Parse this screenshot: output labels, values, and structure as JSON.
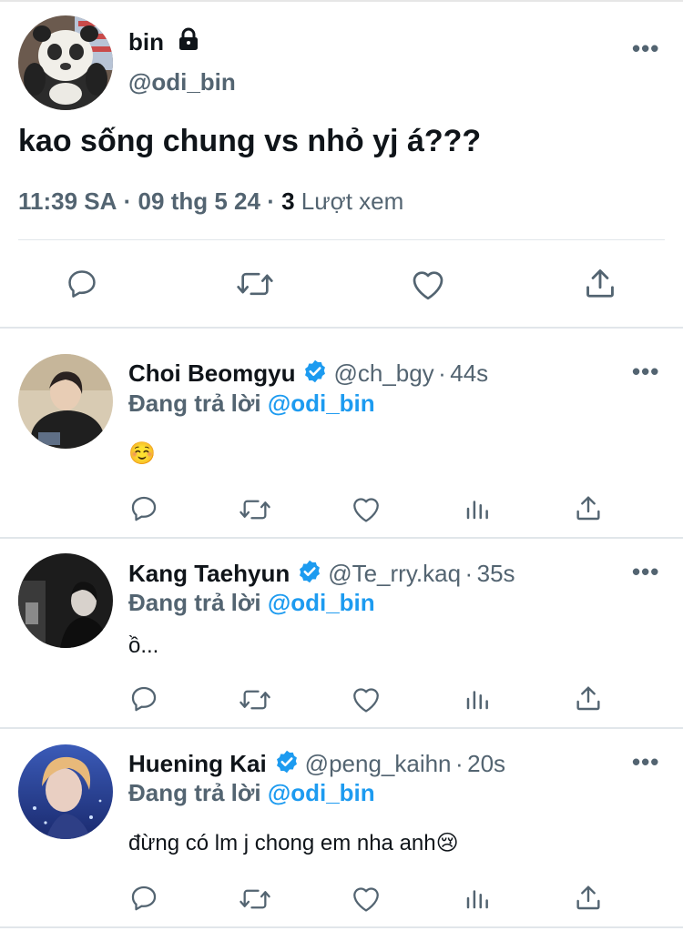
{
  "main_tweet": {
    "author_name": "bin",
    "lock_icon": "lock-icon",
    "author_handle": "@odi_bin",
    "text": "kao sống chung vs nhỏ yj á???",
    "time": "11:39 SA",
    "separator": "·",
    "date": "09 thg 5 24",
    "views_count": "3",
    "views_label": "Lượt xem",
    "more_label": "•••"
  },
  "replies": [
    {
      "name": "Choi Beomgyu",
      "handle": "@ch_bgy",
      "dot": "·",
      "time": "44s",
      "replying_label": "Đang trả lời",
      "mention": "@odi_bin",
      "text": "☺️",
      "more_label": "•••"
    },
    {
      "name": "Kang Taehyun",
      "handle": "@Te_rry.kaq",
      "dot": "·",
      "time": "35s",
      "replying_label": "Đang trả lời",
      "mention": "@odi_bin",
      "text": "ồ...",
      "more_label": "•••"
    },
    {
      "name": "Huening Kai",
      "handle": "@peng_kaihn",
      "dot": "·",
      "time": "20s",
      "replying_label": "Đang trả lời",
      "mention": "@odi_bin",
      "text": "đừng có lm j chong em nha anh😢",
      "more_label": "•••"
    }
  ],
  "colors": {
    "text": "#0f1419",
    "secondary": "#536471",
    "accent": "#1d9bf0",
    "verified": "#1d9bf0",
    "divider": "#e1e6ea"
  },
  "icons": [
    "reply-icon",
    "retweet-icon",
    "like-icon",
    "views-icon",
    "share-icon",
    "verified-badge-icon"
  ]
}
